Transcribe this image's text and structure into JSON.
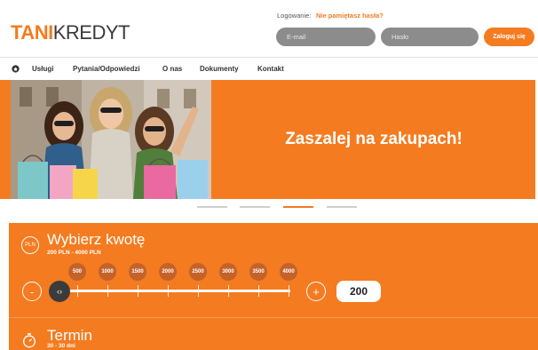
{
  "brand": {
    "logo_accent": "TANI",
    "logo_rest": "KREDYT",
    "accent_color": "#f47b20"
  },
  "login": {
    "label": "Logowanie:",
    "forgot": "Nie pamiętasz hasła?",
    "email_placeholder": "E-mail",
    "password_placeholder": "Hasło",
    "submit": "Zaloguj się"
  },
  "nav": {
    "items": [
      "Usługi",
      "Pytania/Odpowiedzi",
      "O nas",
      "Dokumenty",
      "Kontakt"
    ]
  },
  "hero": {
    "title": "Zaszalej na zakupach!"
  },
  "slider_dots": {
    "count": 4,
    "active_index": 2
  },
  "calculator": {
    "currency_icon_text": "PLN",
    "amount_title": "Wybierz kwotę",
    "amount_range": "200 PLN - 4000 PLN",
    "scale_labels": [
      "500",
      "1000",
      "1500",
      "2000",
      "2500",
      "3000",
      "3500",
      "4000"
    ],
    "minus": "-",
    "plus": "+",
    "handle_glyph": "‹›",
    "amount_value": "200",
    "term_title": "Termin",
    "term_range": "30 - 30 dni"
  }
}
